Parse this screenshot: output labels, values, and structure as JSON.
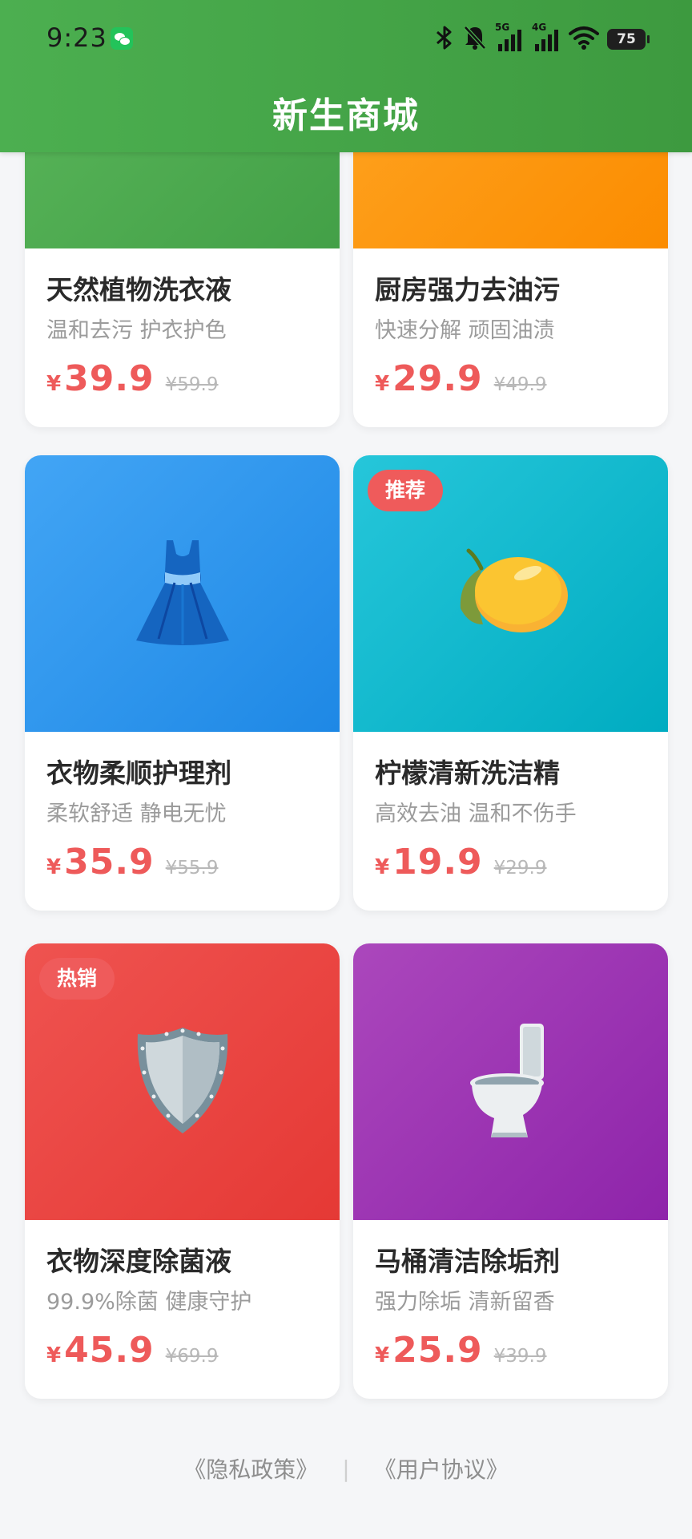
{
  "status_bar": {
    "time": "9:23",
    "network_5g": "5G",
    "network_4g": "4G",
    "battery": "75"
  },
  "header": {
    "title": "新生商城"
  },
  "currency_symbol": "¥",
  "products": [
    {
      "title": "天然植物洗衣液",
      "subtitle": "温和去污 护衣护色",
      "price": "39.9",
      "original_price": "¥59.9",
      "badge": "",
      "gradient": [
        "#5cb85c",
        "#43a047"
      ],
      "icon": "bottle-icon"
    },
    {
      "title": "厨房强力去油污",
      "subtitle": "快速分解 顽固油渍",
      "price": "29.9",
      "original_price": "¥49.9",
      "badge": "",
      "gradient": [
        "#ffa726",
        "#fb8c00"
      ],
      "icon": "cleaning-icon"
    },
    {
      "title": "衣物柔顺护理剂",
      "subtitle": "柔软舒适 静电无忧",
      "price": "35.9",
      "original_price": "¥55.9",
      "badge": "",
      "gradient": [
        "#42a5f5",
        "#1e88e5"
      ],
      "icon": "dress-icon"
    },
    {
      "title": "柠檬清新洗洁精",
      "subtitle": "高效去油 温和不伤手",
      "price": "19.9",
      "original_price": "¥29.9",
      "badge": "推荐",
      "gradient": [
        "#26c6da",
        "#00acc1"
      ],
      "icon": "lemon-icon"
    },
    {
      "title": "衣物深度除菌液",
      "subtitle": "99.9%除菌 健康守护",
      "price": "45.9",
      "original_price": "¥69.9",
      "badge": "热销",
      "gradient": [
        "#ef5350",
        "#e53935"
      ],
      "icon": "shield-icon"
    },
    {
      "title": "马桶清洁除垢剂",
      "subtitle": "强力除垢 清新留香",
      "price": "25.9",
      "original_price": "¥39.9",
      "badge": "",
      "gradient": [
        "#ab47bc",
        "#8e24aa"
      ],
      "icon": "toilet-icon"
    }
  ],
  "footer": {
    "privacy_link": "《隐私政策》",
    "separator": "|",
    "agreement_link": "《用户协议》"
  }
}
